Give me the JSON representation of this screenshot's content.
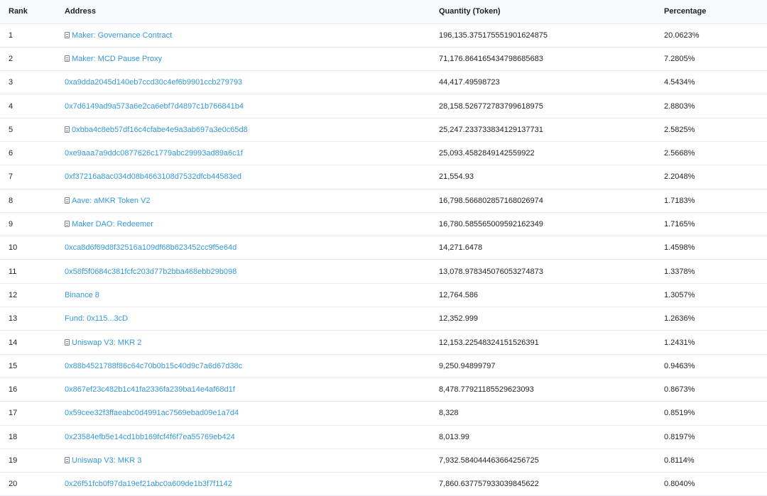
{
  "table": {
    "headers": {
      "rank": "Rank",
      "address": "Address",
      "quantity": "Quantity (Token)",
      "percentage": "Percentage"
    },
    "rows": [
      {
        "rank": "1",
        "address": "Maker: Governance Contract",
        "is_contract": true,
        "quantity": "196,135.375175551901624875",
        "percentage": "20.0623%"
      },
      {
        "rank": "2",
        "address": "Maker: MCD Pause Proxy",
        "is_contract": true,
        "quantity": "71,176.864165434798685683",
        "percentage": "7.2805%"
      },
      {
        "rank": "3",
        "address": "0xa9dda2045d140eb7ccd30c4ef6b9901ccb279793",
        "is_contract": false,
        "quantity": "44,417.49598723",
        "percentage": "4.5434%"
      },
      {
        "rank": "4",
        "address": "0x7d6149ad9a573a6e2ca6ebf7d4897c1b766841b4",
        "is_contract": false,
        "quantity": "28,158.526772783799618975",
        "percentage": "2.8803%"
      },
      {
        "rank": "5",
        "address": "0xbba4c8eb57df16c4cfabe4e9a3ab697a3e0c65d8",
        "is_contract": true,
        "quantity": "25,247.233733834129137731",
        "percentage": "2.5825%"
      },
      {
        "rank": "6",
        "address": "0xe9aaa7a9ddc0877626c1779abc29993ad89a6c1f",
        "is_contract": false,
        "quantity": "25,093.4582849142559922",
        "percentage": "2.5668%"
      },
      {
        "rank": "7",
        "address": "0xf37216a8ac034d08b4663108d7532dfcb44583ed",
        "is_contract": false,
        "quantity": "21,554.93",
        "percentage": "2.2048%"
      },
      {
        "rank": "8",
        "address": "Aave: aMKR Token V2",
        "is_contract": true,
        "quantity": "16,798.566802857168026974",
        "percentage": "1.7183%"
      },
      {
        "rank": "9",
        "address": "Maker DAO: Redeemer",
        "is_contract": true,
        "quantity": "16,780.585565009592162349",
        "percentage": "1.7165%"
      },
      {
        "rank": "10",
        "address": "0xca8d6f69d8f32516a109df68b623452cc9f5e64d",
        "is_contract": false,
        "quantity": "14,271.6478",
        "percentage": "1.4598%"
      },
      {
        "rank": "11",
        "address": "0x58f5f0684c381fcfc203d77b2bba468ebb29b098",
        "is_contract": false,
        "quantity": "13,078.978345076053274873",
        "percentage": "1.3378%"
      },
      {
        "rank": "12",
        "address": "Binance 8",
        "is_contract": false,
        "quantity": "12,764.586",
        "percentage": "1.3057%"
      },
      {
        "rank": "13",
        "address": "Fund: 0x115...3cD",
        "is_contract": false,
        "quantity": "12,352.999",
        "percentage": "1.2636%"
      },
      {
        "rank": "14",
        "address": "Uniswap V3: MKR 2",
        "is_contract": true,
        "quantity": "12,153.22548324151526391",
        "percentage": "1.2431%"
      },
      {
        "rank": "15",
        "address": "0x88b4521788f86c64c70b0b15c40d9c7a6d67d38c",
        "is_contract": false,
        "quantity": "9,250.94899797",
        "percentage": "0.9463%"
      },
      {
        "rank": "16",
        "address": "0x867ef23c482b1c41fa2336fa239ba14e4af68d1f",
        "is_contract": false,
        "quantity": "8,478.77921185529623093",
        "percentage": "0.8673%"
      },
      {
        "rank": "17",
        "address": "0x59cee32f3ffaeabc0d4991ac7569ebad09e1a7d4",
        "is_contract": false,
        "quantity": "8,328",
        "percentage": "0.8519%"
      },
      {
        "rank": "18",
        "address": "0x23584efb5e14cd1bb169fcf4f6f7ea55769eb424",
        "is_contract": false,
        "quantity": "8,013.99",
        "percentage": "0.8197%"
      },
      {
        "rank": "19",
        "address": "Uniswap V3: MKR 3",
        "is_contract": true,
        "quantity": "7,932.584044463664256725",
        "percentage": "0.8114%"
      },
      {
        "rank": "20",
        "address": "0x26f51fcb0f97da19ef21abc0a609de1b3f7f1142",
        "is_contract": false,
        "quantity": "7,860.637757933039845622",
        "percentage": "0.8040%"
      }
    ]
  },
  "colors": {
    "link": "#3498db",
    "text": "#1e2022",
    "header_bg": "#f8f9fa",
    "border": "#e7eaf3",
    "icon": "#77838f"
  },
  "icons": {
    "contract": "contract-file-icon"
  }
}
